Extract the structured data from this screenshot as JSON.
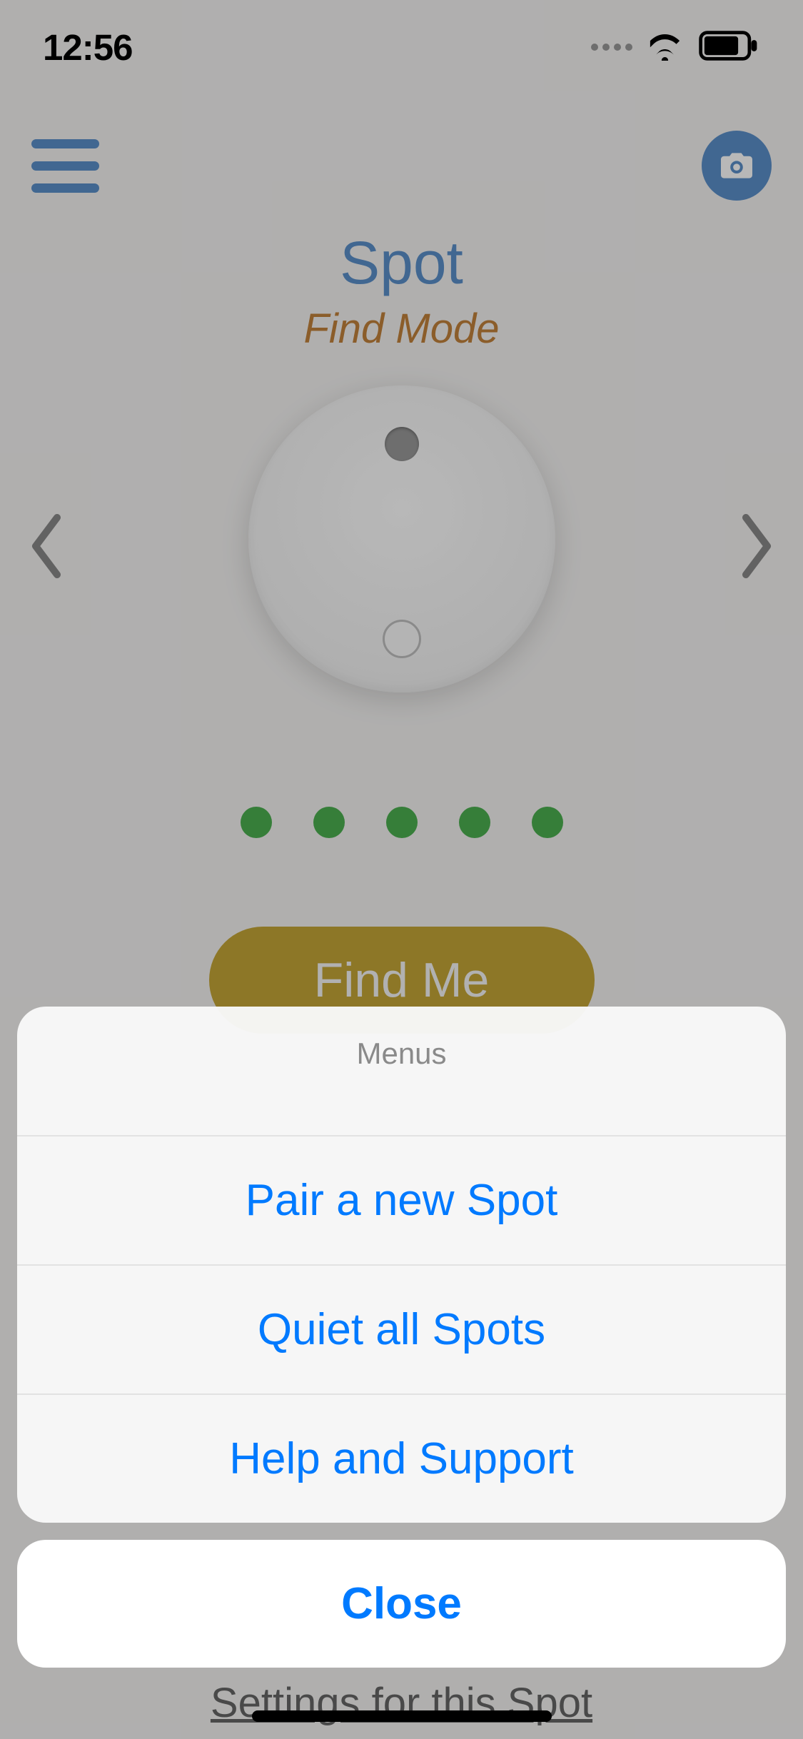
{
  "status": {
    "time": "12:56"
  },
  "main": {
    "device_name": "Spot",
    "mode_label": "Find Mode",
    "find_button_label": "Find Me",
    "settings_link": "Settings for this Spot",
    "signal_strength": 5
  },
  "action_sheet": {
    "title": "Menus",
    "items": [
      {
        "label": "Pair a new Spot"
      },
      {
        "label": "Quiet all Spots"
      },
      {
        "label": "Help and Support"
      }
    ],
    "close_label": "Close"
  }
}
